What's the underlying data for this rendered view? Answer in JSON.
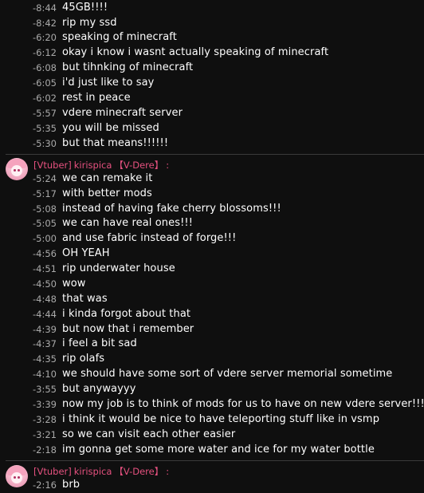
{
  "group1": [
    {
      "ts": "-8:44",
      "text": "45GB!!!!"
    },
    {
      "ts": "-8:42",
      "text": "rip my ssd"
    },
    {
      "ts": "-6:20",
      "text": "speaking of minecraft"
    },
    {
      "ts": "-6:12",
      "text": "okay i know i wasnt actually speaking of minecraft"
    },
    {
      "ts": "-6:08",
      "text": "but tihnking of minecraft"
    },
    {
      "ts": "-6:05",
      "text": "i'd just like to say"
    },
    {
      "ts": "-6:02",
      "text": "rest in peace"
    },
    {
      "ts": "-5:57",
      "text": "vdere minecraft server"
    },
    {
      "ts": "-5:35",
      "text": "you will be missed"
    },
    {
      "ts": "-5:30",
      "text": "but that means!!!!!!"
    }
  ],
  "group2": {
    "author": {
      "role": "[Vtuber]",
      "name": "kirispica",
      "badge": "【V-Dere】",
      "colon": ":"
    },
    "lines": [
      {
        "ts": "-5:24",
        "text": "we can remake it"
      },
      {
        "ts": "-5:17",
        "text": "with better mods"
      },
      {
        "ts": "-5:08",
        "text": "instead of having fake cherry blossoms!!!"
      },
      {
        "ts": "-5:05",
        "text": "we can have real ones!!!"
      },
      {
        "ts": "-5:00",
        "text": "and use fabric instead of forge!!!"
      },
      {
        "ts": "-4:56",
        "text": "OH YEAH"
      },
      {
        "ts": "-4:51",
        "text": "rip underwater house"
      },
      {
        "ts": "-4:50",
        "text": "wow"
      },
      {
        "ts": "-4:48",
        "text": "that was"
      },
      {
        "ts": "-4:44",
        "text": "i kinda forgot about that"
      },
      {
        "ts": "-4:39",
        "text": "but now that i remember"
      },
      {
        "ts": "-4:37",
        "text": "i feel a bit sad"
      },
      {
        "ts": "-4:35",
        "text": "rip olafs"
      },
      {
        "ts": "-4:10",
        "text": "we should have some sort of vdere server memorial sometime"
      },
      {
        "ts": "-3:55",
        "text": "but anywayyy"
      },
      {
        "ts": "-3:39",
        "text": "now my job is to think of mods for us to have on new vdere server!!!!"
      },
      {
        "ts": "-3:28",
        "text": "i think it would be nice to have teleporting stuff like in vsmp"
      },
      {
        "ts": "-3:21",
        "text": "so we can visit each other easier"
      },
      {
        "ts": "-2:18",
        "text": "im gonna get some more water and ice for my water bottle"
      }
    ]
  },
  "group3": {
    "author": {
      "role": "[Vtuber]",
      "name": "kirispica",
      "badge": "【V-Dere】",
      "colon": ":"
    },
    "lines": [
      {
        "ts": "-2:16",
        "text": "brb"
      }
    ]
  }
}
